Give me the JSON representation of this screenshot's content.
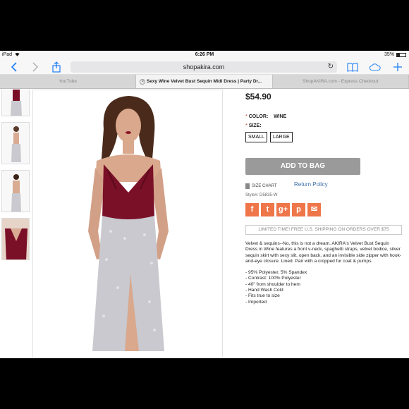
{
  "status_bar": {
    "device": "iPad",
    "time": "6:26 PM",
    "battery": "35%"
  },
  "toolbar": {
    "address": "shopakira.com"
  },
  "tabs": [
    {
      "label": "YouTube",
      "active": false
    },
    {
      "label": "Sexy Wine Velvet Bust Sequin Midi Dress | Party Dr...",
      "active": true
    },
    {
      "label": "ShopAKIRA.com - Express Checkout",
      "active": false
    }
  ],
  "product": {
    "price": "$54.90",
    "color_label": "COLOR:",
    "color_value": "WINE",
    "size_label": "SIZE:",
    "sizes": [
      "SMALL",
      "LARGE"
    ],
    "add_to_bag": "ADD TO BAG",
    "size_chart": "SIZE CHART",
    "return_policy": "Return Policy",
    "style": "Style#: D5835-W",
    "promo": "LIMITED TIME! FREE U.S. SHIPPING ON ORDERS OVER $75",
    "description": "Velvet & sequins--No, this is not a dream. AKIRA's Velvet Bust Sequin Dress in Wine features a front v-neck, spaghetti straps, velvet bodice, silver sequin skirt with sexy slit, open back, and an invisible side zipper with hook-and-eye closure. Lined. Pair with a cropped fur coat & pumps.",
    "specs": [
      "- 95% Polyester, 5% Spandex",
      "- Contrast: 100% Polyester",
      "- 40\" from shoulder to hem",
      "- Hand Wash Cold",
      "- Fits true to size",
      "- Imported"
    ]
  },
  "social": [
    {
      "icon": "facebook-icon",
      "glyph": "f"
    },
    {
      "icon": "twitter-icon",
      "glyph": "t"
    },
    {
      "icon": "google-plus-icon",
      "glyph": "g+"
    },
    {
      "icon": "pinterest-icon",
      "glyph": "p"
    },
    {
      "icon": "email-icon",
      "glyph": "✉"
    }
  ],
  "colors": {
    "accent": "#1a7cf5",
    "velvet": "#7a1028",
    "sequin": "#c9c9cf",
    "social": "#ee7649",
    "button": "#9a9a9a"
  }
}
